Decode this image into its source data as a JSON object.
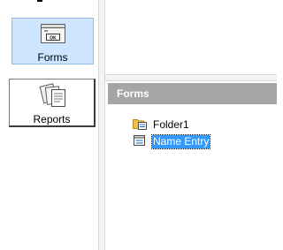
{
  "nav": {
    "items": [
      {
        "label": "Forms",
        "icon": "form-icon",
        "selected": true
      },
      {
        "label": "Reports",
        "icon": "report-icon",
        "selected": false
      }
    ]
  },
  "panel": {
    "header": "Forms"
  },
  "tree": {
    "items": [
      {
        "label": "Folder1",
        "icon": "folder-form-icon",
        "selected": false
      },
      {
        "label": "Name Entry",
        "icon": "form-document-icon",
        "selected": true
      }
    ]
  },
  "colors": {
    "selected_nav_bg": "#cde5ff",
    "header_bg": "#a5a5a5",
    "selection_bg": "#3399ff"
  }
}
